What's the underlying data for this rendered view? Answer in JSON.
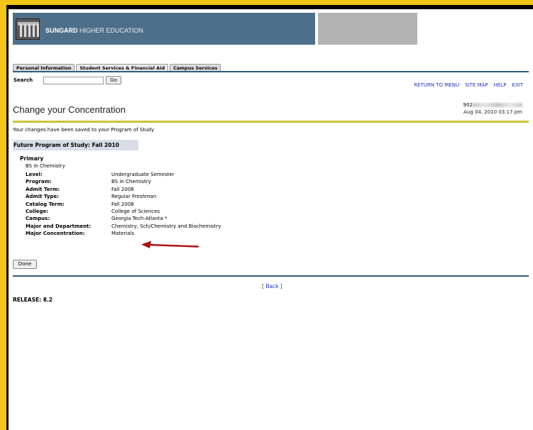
{
  "header": {
    "brand_bold": "SUNGARD",
    "brand_light": "HIGHER EDUCATION"
  },
  "tabs": [
    {
      "label": "Personal Information"
    },
    {
      "label": "Student Services & Financial Aid"
    },
    {
      "label": "Campus Services"
    }
  ],
  "search": {
    "label": "Search",
    "value": "",
    "go_label": "Go"
  },
  "toplinks": [
    {
      "label": "RETURN TO MENU"
    },
    {
      "label": "SITE MAP"
    },
    {
      "label": "HELP"
    },
    {
      "label": "EXIT"
    }
  ],
  "page": {
    "title": "Change your Concentration",
    "user_id_prefix": "902",
    "timestamp": "Aug 04, 2010 03:17 pm",
    "saved_message": "Your changes have been saved to your Program of Study",
    "program_header": "Future Program of Study: Fall 2010",
    "primary_label": "Primary",
    "degree": "BS in Chemistry",
    "details": [
      {
        "label": "Level:",
        "value": "Undergraduate Semester"
      },
      {
        "label": "Program:",
        "value": "BS in Chemistry"
      },
      {
        "label": "Admit Term:",
        "value": "Fall 2008"
      },
      {
        "label": "Admit Type:",
        "value": "Regular Freshman"
      },
      {
        "label": "Catalog Term:",
        "value": "Fall 2008"
      },
      {
        "label": "College:",
        "value": "College of Sciences"
      },
      {
        "label": "Campus:",
        "value": "Georgia Tech-Atlanta *"
      },
      {
        "label": "Major and Department:",
        "value": "Chemistry, Sch/Chemistry and Biochemistry"
      },
      {
        "label": "Major Concentration:",
        "value": "Materials"
      }
    ],
    "done_label": "Done",
    "back_open": "[ ",
    "back_label": "Back",
    "back_close": " ]",
    "release": "RELEASE: 8.2"
  },
  "colors": {
    "outer_border": "#f5c518",
    "banner_blue": "#4e6f89",
    "rule_blue": "#2e5d7b",
    "rule_yellow": "#c9c43a",
    "link_blue": "#2230c0",
    "arrow_red": "#b01010"
  }
}
